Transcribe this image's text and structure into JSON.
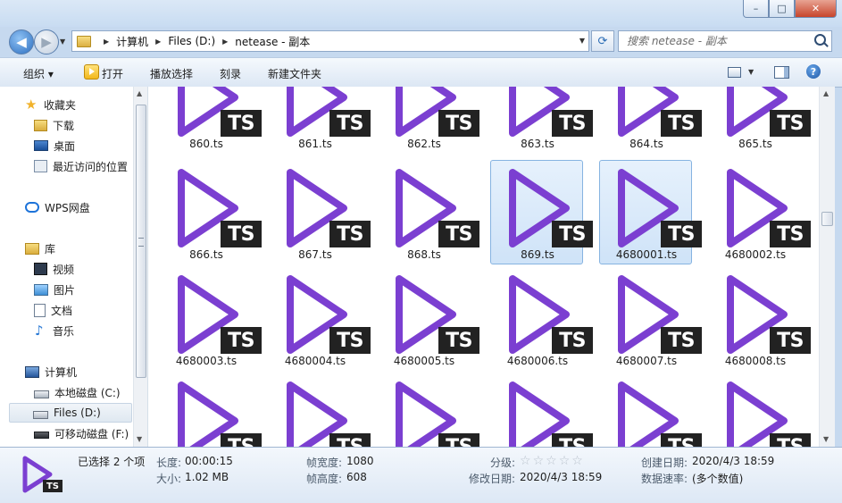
{
  "window": {
    "min": "–",
    "max": "□",
    "close": "✕"
  },
  "address": {
    "crumbs": [
      "计算机",
      "Files (D:)",
      "netease - 副本"
    ]
  },
  "search": {
    "placeholder": "搜索 netease - 副本"
  },
  "toolbar": {
    "organize": "组织 ▾",
    "open": "打开",
    "play": "播放选择",
    "burn": "刻录",
    "new_folder": "新建文件夹",
    "help": "?"
  },
  "nav": {
    "favorites": "收藏夹",
    "downloads": "下载",
    "desktop": "桌面",
    "recent": "最近访问的位置",
    "wps": "WPS网盘",
    "libraries": "库",
    "videos": "视频",
    "pictures": "图片",
    "documents": "文档",
    "music": "音乐",
    "computer": "计算机",
    "local_c": "本地磁盘 (C:)",
    "files_d": "Files (D:)",
    "removable_f": "可移动磁盘 (F:)"
  },
  "files": {
    "badge": "TS",
    "rows": [
      [
        "860.ts",
        "861.ts",
        "862.ts",
        "863.ts",
        "864.ts",
        "865.ts"
      ],
      [
        "866.ts",
        "867.ts",
        "868.ts",
        "869.ts",
        "4680001.ts",
        "4680002.ts"
      ],
      [
        "4680003.ts",
        "4680004.ts",
        "4680005.ts",
        "4680006.ts",
        "4680007.ts",
        "4680008.ts"
      ],
      [
        "",
        "",
        "",
        "",
        "",
        ""
      ]
    ],
    "selected": [
      "869.ts",
      "4680001.ts"
    ],
    "accent_color": "#7b3fd1"
  },
  "details": {
    "selection": "已选择 2 个项",
    "length_label": "长度:",
    "length": "00:00:15",
    "size_label": "大小:",
    "size": "1.02 MB",
    "width_label": "帧宽度:",
    "width": "1080",
    "height_label": "帧高度:",
    "height": "608",
    "rating_label": "分级:",
    "modified_label": "修改日期:",
    "modified": "2020/4/3 18:59",
    "created_label": "创建日期:",
    "created": "2020/4/3 18:59",
    "rate_label": "数据速率:",
    "rate": "(多个数值)",
    "badge": "TS"
  }
}
